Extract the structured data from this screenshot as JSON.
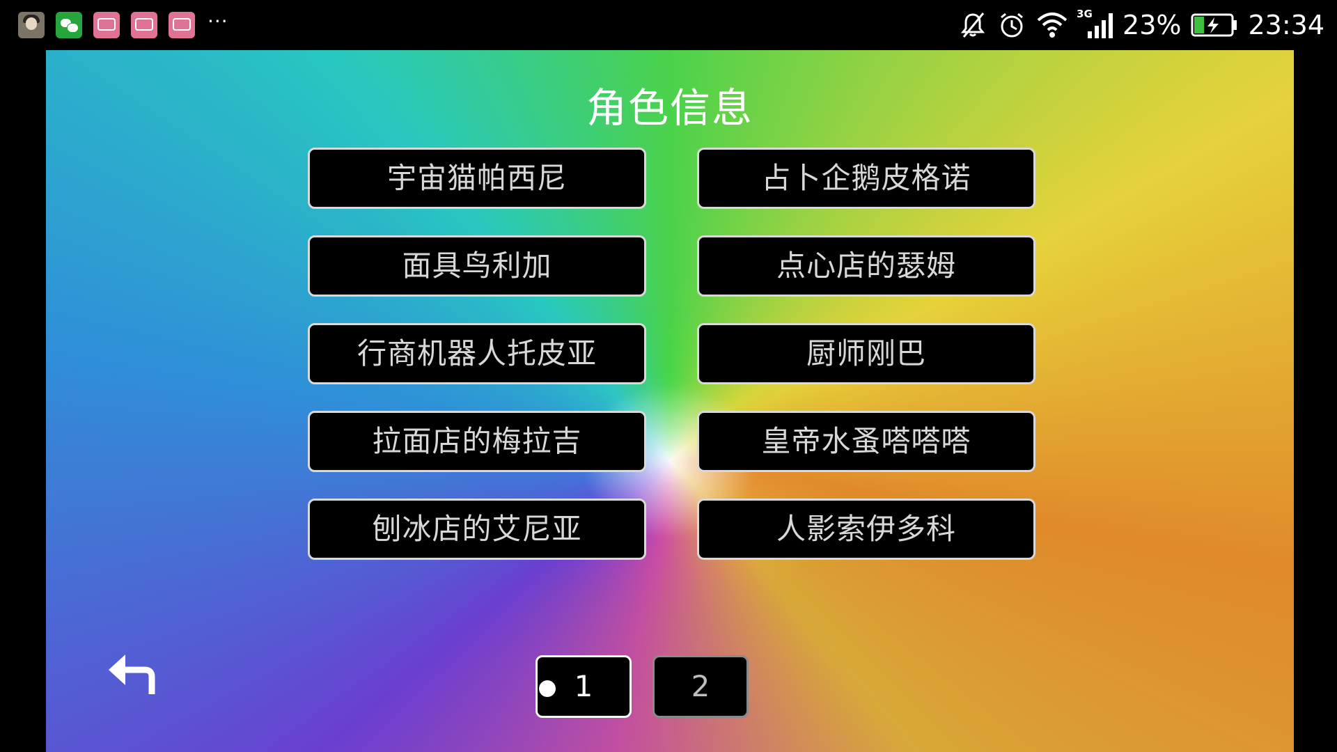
{
  "status_bar": {
    "notification_icons": [
      "avatar-icon",
      "wechat-icon",
      "bilibili-icon",
      "bilibili-icon",
      "bilibili-icon"
    ],
    "more": "···",
    "network": "3G",
    "battery_percent": "23%",
    "time": "23:34"
  },
  "screen": {
    "title": "角色信息",
    "characters": [
      "宇宙猫帕西尼",
      "占卜企鹅皮格诺",
      "面具鸟利加",
      "点心店的瑟姆",
      "行商机器人托皮亚",
      "厨师刚巴",
      "拉面店的梅拉吉",
      "皇帝水蚤嗒嗒嗒",
      "刨冰店的艾尼亚",
      "人影索伊多科"
    ],
    "pages": [
      "1",
      "2"
    ],
    "current_page": "1"
  }
}
